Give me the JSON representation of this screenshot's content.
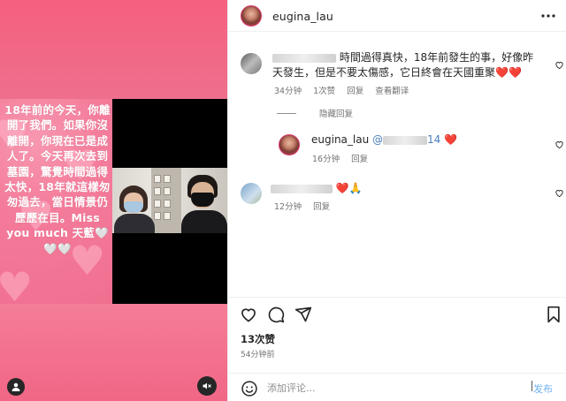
{
  "media": {
    "caption": "18年前的今天，你離開了我們。如果你沒離開，你現在已是成人了。今天再次去到墓園，驚覺時間過得太快，18年就這樣匆匆過去，當日情景仍歷歷在目。Miss you much 天藍🤍 🤍🤍"
  },
  "header": {
    "username": "eugina_lau"
  },
  "comments": [
    {
      "text": "時間過得真快，18年前發生的事，好像昨天發生，但是不要太傷感，它日終會在天國重聚",
      "emoji": "❤️❤️",
      "time": "34分钟",
      "likes": "1次赞",
      "reply": "回复",
      "translate": "查看翻译"
    },
    {
      "hidden_replies": "隐藏回复"
    },
    {
      "username": "eugina_lau",
      "mention": "@",
      "mention_suffix": "14",
      "emoji": "❤️",
      "time": "16分钟",
      "reply": "回复"
    },
    {
      "emoji": "❤️🙏",
      "time": "12分钟",
      "reply": "回复"
    }
  ],
  "post": {
    "likes": "13次赞",
    "time_ago": "54分钟前"
  },
  "add_comment": {
    "placeholder": "添加评论...",
    "post_label": "发布"
  },
  "colors": {
    "heart_red": "#ed1c3a",
    "link_blue": "#6fb0f2",
    "pink_bg": "#f06e8f"
  }
}
